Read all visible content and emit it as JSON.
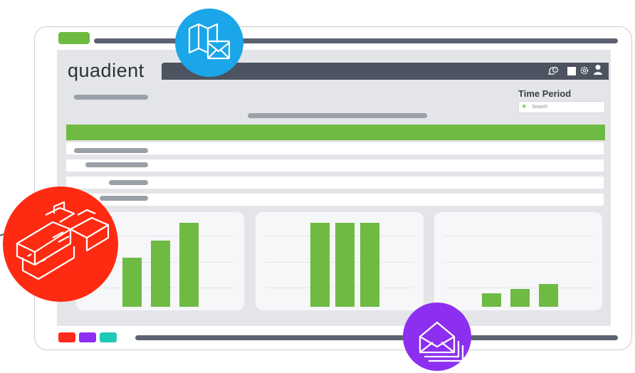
{
  "app": {
    "logo_text": "quadient",
    "accent_color": "#6fba43",
    "topbar_color": "#4d5360"
  },
  "toolbar": {
    "icons": [
      "bell-clock-icon",
      "square-icon",
      "gear-icon",
      "user-icon"
    ]
  },
  "filter": {
    "title": "Time Period",
    "search_placeholder": "Search"
  },
  "dock_colors": [
    "#ff2a1a",
    "#8c2ff0",
    "#1ec9b8"
  ],
  "badges": [
    {
      "name": "map-envelope-icon",
      "color": "#1aa6e8"
    },
    {
      "name": "mailing-machine-icon",
      "color": "#ff2a12"
    },
    {
      "name": "envelopes-stack-icon",
      "color": "#8c2ff0"
    }
  ],
  "chart_data": [
    {
      "type": "bar",
      "values": [
        3,
        4,
        5.1
      ]
    },
    {
      "type": "bar",
      "values": [
        5.1,
        5.1,
        5.1
      ]
    },
    {
      "type": "bar",
      "values": [
        0.8,
        1.1,
        1.4
      ]
    }
  ]
}
